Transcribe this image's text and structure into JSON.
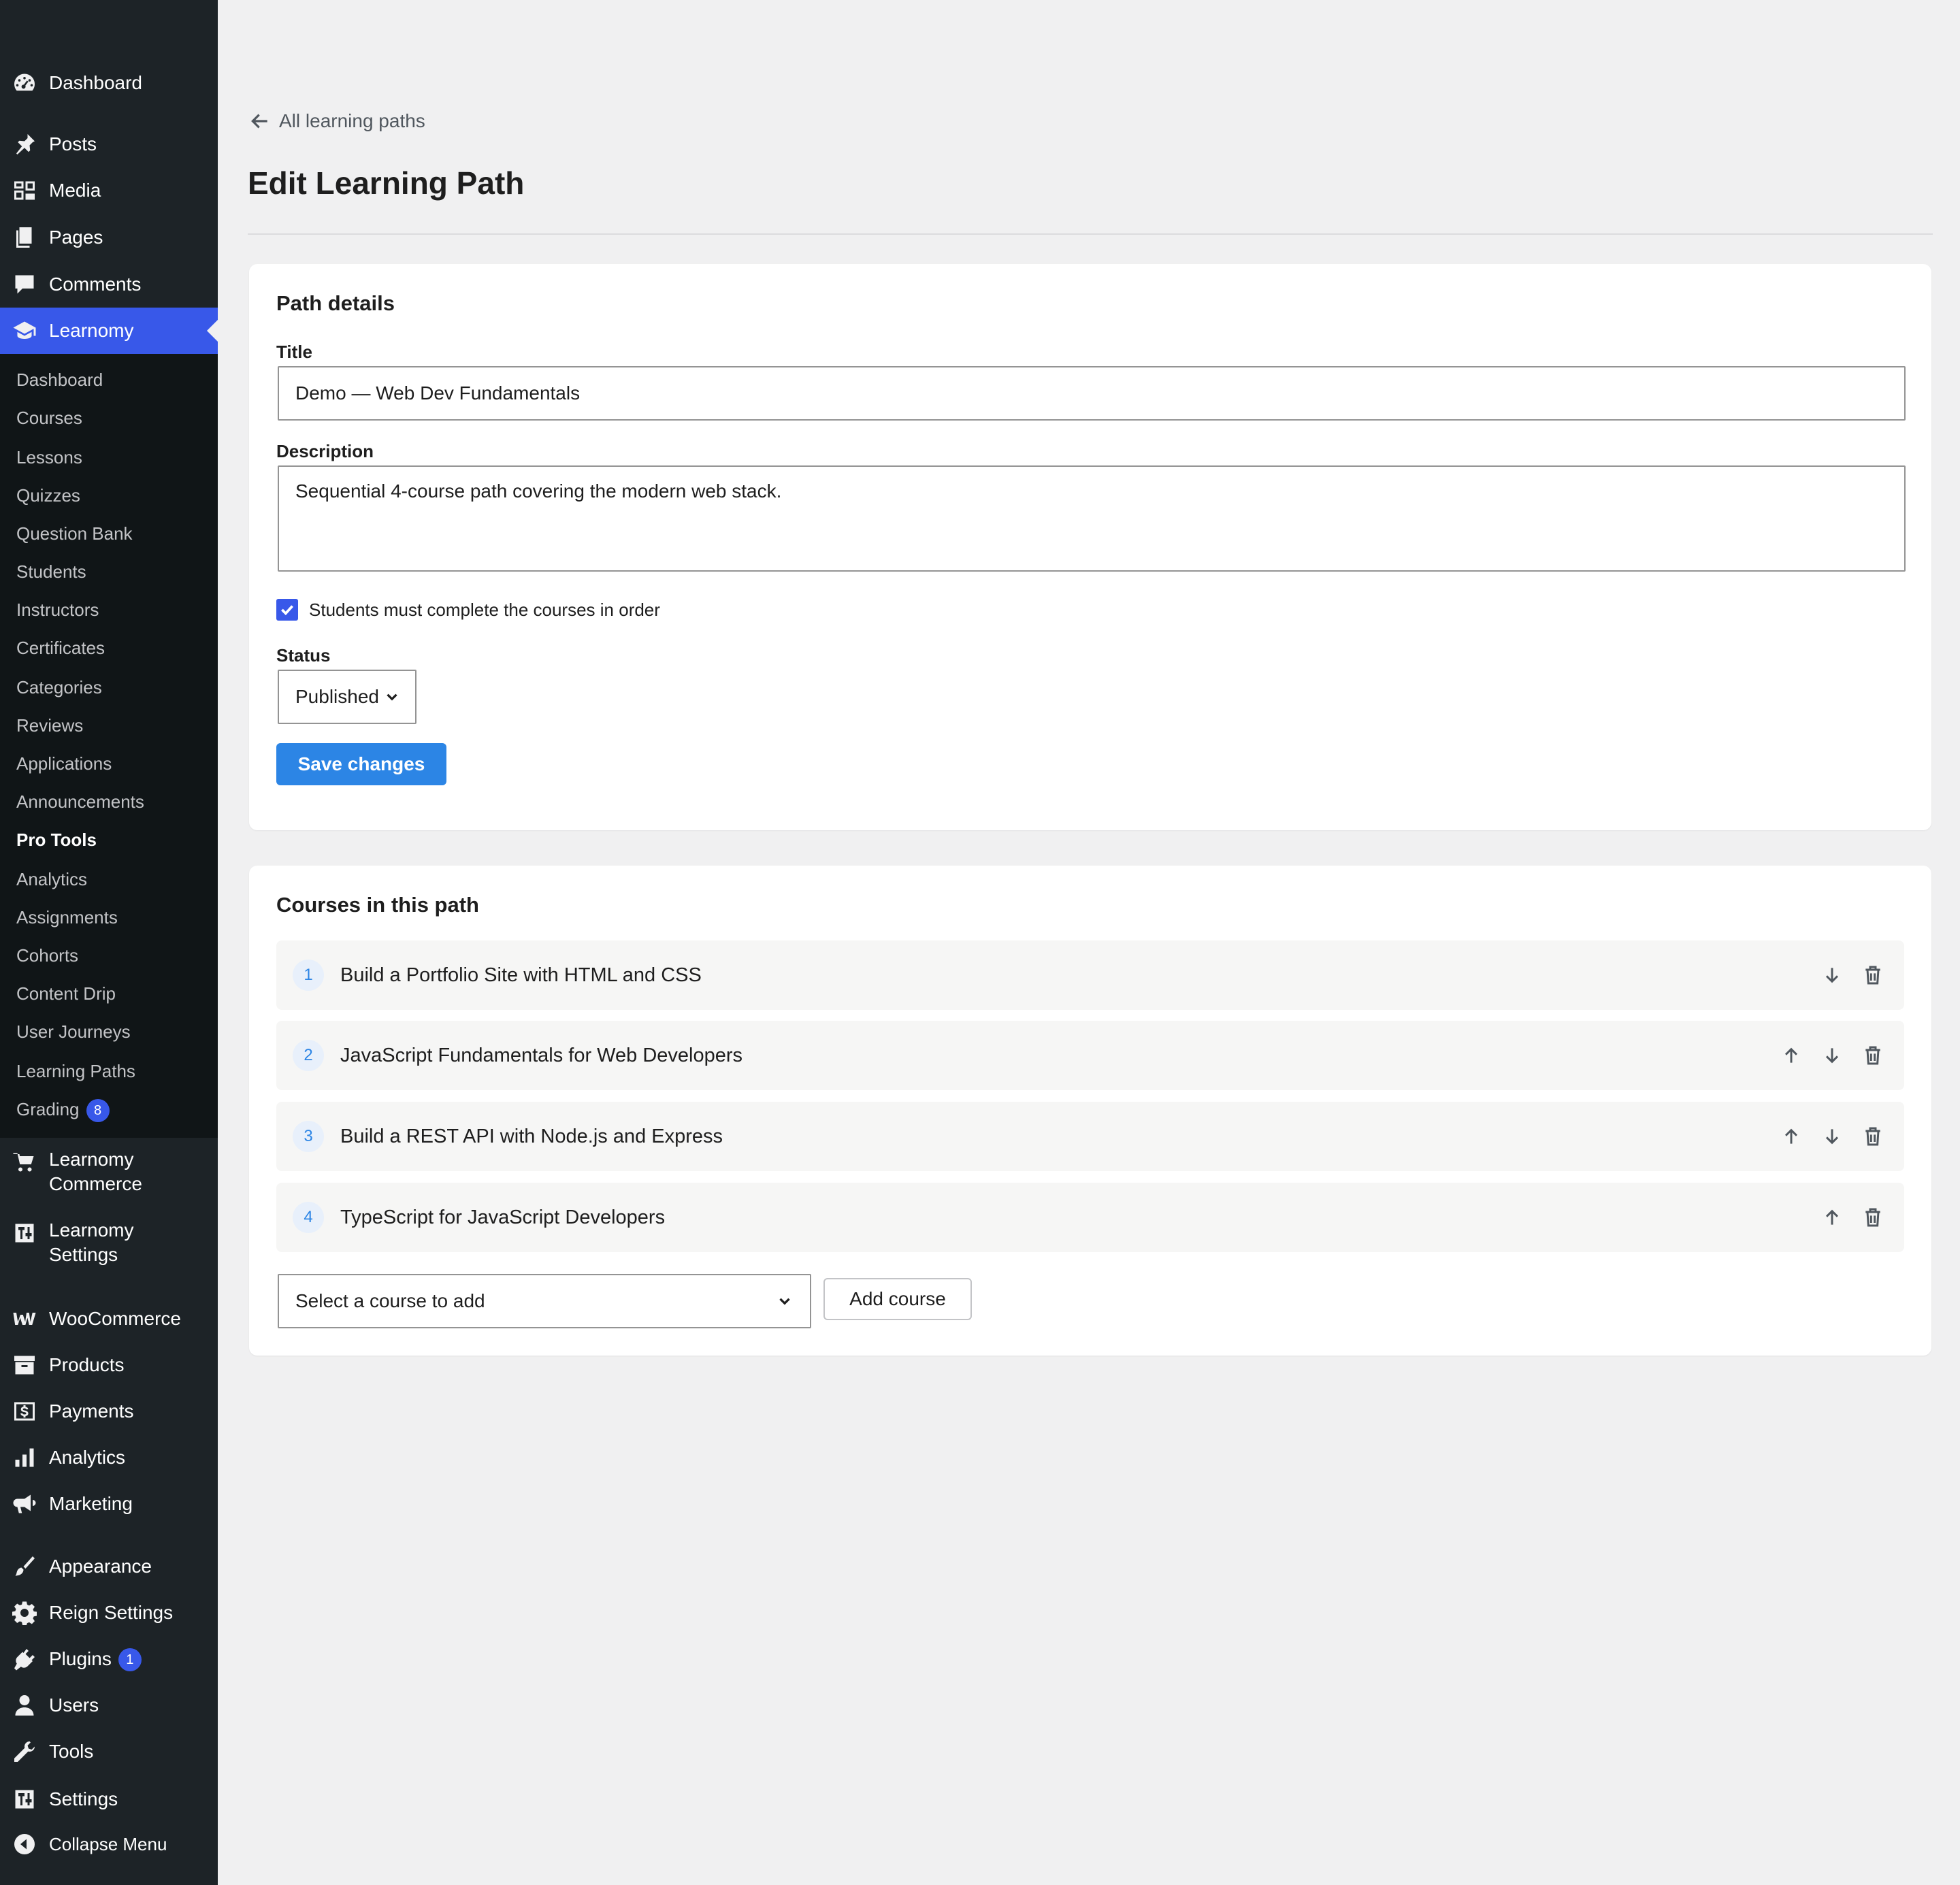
{
  "sidebar": {
    "top_items": [
      {
        "label": "Dashboard",
        "icon": "dashboard-icon"
      },
      {
        "label": "Posts",
        "icon": "pin-icon"
      },
      {
        "label": "Media",
        "icon": "media-icon"
      },
      {
        "label": "Pages",
        "icon": "pages-icon"
      },
      {
        "label": "Comments",
        "icon": "comment-icon"
      },
      {
        "label": "Learnomy",
        "icon": "graduation-cap-icon"
      }
    ],
    "submenu": [
      "Dashboard",
      "Courses",
      "Lessons",
      "Quizzes",
      "Question Bank",
      "Students",
      "Instructors",
      "Certificates",
      "Categories",
      "Reviews",
      "Applications",
      "Announcements",
      "Pro Tools",
      "Analytics",
      "Assignments",
      "Cohorts",
      "Content Drip",
      "User Journeys",
      "Learning Paths",
      "Grading"
    ],
    "grading_badge": "8",
    "bottom_items": [
      {
        "label": "Learnomy Commerce",
        "icon": "cart-icon"
      },
      {
        "label": "Learnomy Settings",
        "icon": "settings-sliders-icon"
      },
      {
        "label": "WooCommerce",
        "icon": "woo-icon"
      },
      {
        "label": "Products",
        "icon": "archive-icon"
      },
      {
        "label": "Payments",
        "icon": "dollar-icon"
      },
      {
        "label": "Analytics",
        "icon": "bar-chart-icon"
      },
      {
        "label": "Marketing",
        "icon": "megaphone-icon"
      },
      {
        "label": "Appearance",
        "icon": "brush-icon"
      },
      {
        "label": "Reign Settings",
        "icon": "gear-icon"
      },
      {
        "label": "Plugins",
        "icon": "plug-icon"
      },
      {
        "label": "Users",
        "icon": "user-icon"
      },
      {
        "label": "Tools",
        "icon": "wrench-icon"
      },
      {
        "label": "Settings",
        "icon": "settings-sliders-icon"
      },
      {
        "label": "Collapse Menu",
        "icon": "collapse-icon"
      }
    ],
    "plugins_badge": "1",
    "active_color": "#3858e9"
  },
  "header": {
    "back_label": "All learning paths",
    "title": "Edit Learning Path"
  },
  "details": {
    "heading": "Path details",
    "title_label": "Title",
    "title_value": "Demo — Web Dev Fundamentals",
    "description_label": "Description",
    "description_value": "Sequential 4-course path covering the modern web stack.",
    "sequential_label": "Students must complete the courses in order",
    "sequential_checked": true,
    "status_label": "Status",
    "status_value": "Published",
    "save_label": "Save changes"
  },
  "courses": {
    "heading": "Courses in this path",
    "items": [
      {
        "num": "1",
        "name": "Build a Portfolio Site with HTML and CSS"
      },
      {
        "num": "2",
        "name": "JavaScript Fundamentals for Web Developers"
      },
      {
        "num": "3",
        "name": "Build a REST API with Node.js and Express"
      },
      {
        "num": "4",
        "name": "TypeScript for JavaScript Developers"
      }
    ],
    "select_placeholder": "Select a course to add",
    "add_label": "Add course"
  }
}
